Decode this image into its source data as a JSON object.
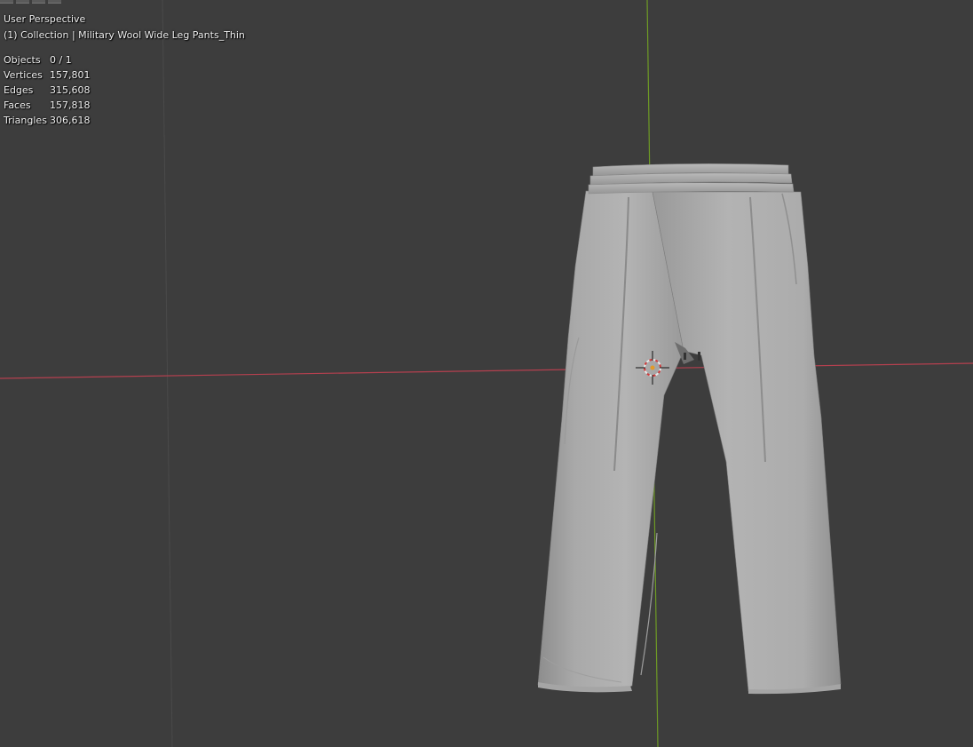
{
  "viewport": {
    "view_name": "User Perspective",
    "collection_info": "(1) Collection | Military Wool Wide Leg Pants_Thin",
    "background": "#3d3d3d"
  },
  "stats": [
    {
      "label": "Objects",
      "value": "0 / 1"
    },
    {
      "label": "Vertices",
      "value": "157,801"
    },
    {
      "label": "Edges",
      "value": "315,608"
    },
    {
      "label": "Faces",
      "value": "157,818"
    },
    {
      "label": "Triangles",
      "value": "306,618"
    }
  ],
  "axes": {
    "x_axis_color": "#b5404f",
    "y_axis_color": "#6e9a25"
  },
  "scene": {
    "object": "pants-mesh",
    "cursor": "3d-cursor-icon"
  }
}
